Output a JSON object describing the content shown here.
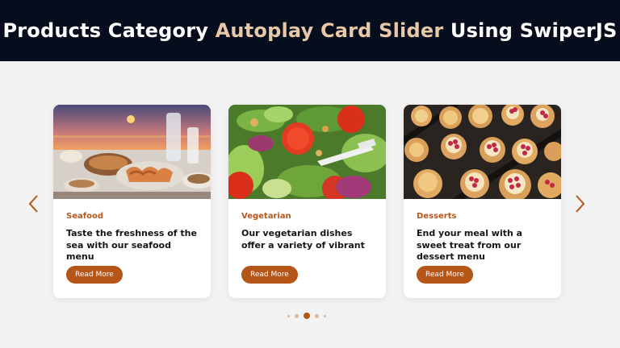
{
  "header": {
    "title_start": "Products Category ",
    "title_accent": "Autoplay Card Slider",
    "title_end": " Using SwiperJS"
  },
  "cards": [
    {
      "category": "Seafood",
      "text": "Taste the freshness of the sea with our seafood menu",
      "button": "Read More",
      "image": "seafood-photo"
    },
    {
      "category": "Vegetarian",
      "text": "Our vegetarian dishes offer a variety of vibrant",
      "button": "Read More",
      "image": "salad-photo"
    },
    {
      "category": "Desserts",
      "text": "End your meal with a sweet treat from our dessert menu",
      "button": "Read More",
      "image": "tarts-photo"
    }
  ],
  "navigation": {
    "prev_icon": "chevron-left-icon",
    "next_icon": "chevron-right-icon"
  },
  "pagination": {
    "count": 5,
    "active_index": 2
  },
  "colors": {
    "header_bg": "#060d1d",
    "accent_text": "#e8c9a7",
    "brand": "#b65518",
    "category_text": "#b7561b"
  }
}
